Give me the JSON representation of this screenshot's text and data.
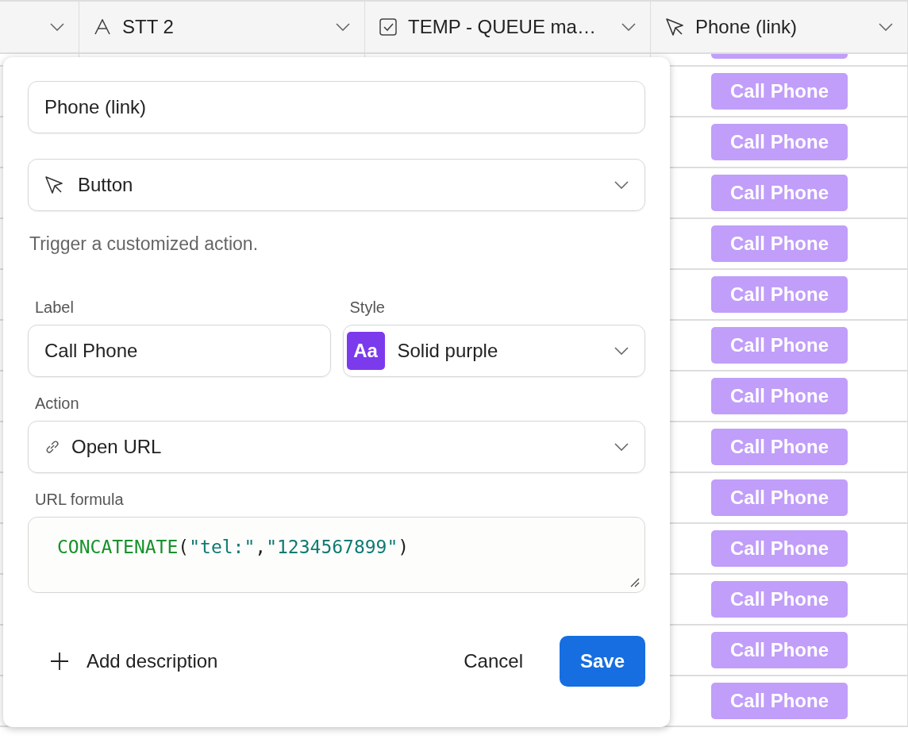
{
  "table": {
    "columns": [
      {
        "kind": "blank"
      },
      {
        "kind": "text",
        "label": "STT 2"
      },
      {
        "kind": "checkbox",
        "label": "TEMP - QUEUE ma…"
      },
      {
        "kind": "button",
        "label": "Phone (link)"
      }
    ],
    "rows": [
      "Call Phone",
      "Call Phone",
      "Call Phone",
      "Call Phone",
      "Call Phone",
      "Call Phone",
      "Call Phone",
      "Call Phone",
      "Call Phone",
      "Call Phone",
      "Call Phone",
      "Call Phone",
      "Call Phone"
    ]
  },
  "dialog": {
    "name": "Phone (link)",
    "field_type": "Button",
    "description": "Trigger a customized action.",
    "label_caption": "Label",
    "label_value": "Call Phone",
    "style_caption": "Style",
    "style_value": "Solid purple",
    "style_swatch": "Aa",
    "action_caption": "Action",
    "action_value": "Open URL",
    "url_caption": "URL formula",
    "formula": [
      {
        "kind": "function",
        "text": "CONCATENATE"
      },
      {
        "kind": "punct",
        "text": "("
      },
      {
        "kind": "string",
        "text": "\"tel:\""
      },
      {
        "kind": "punct",
        "text": ","
      },
      {
        "kind": "string",
        "text": "\"1234567899\""
      },
      {
        "kind": "punct",
        "text": ")"
      }
    ],
    "add_description": "Add description",
    "cancel": "Cancel",
    "save": "Save"
  }
}
